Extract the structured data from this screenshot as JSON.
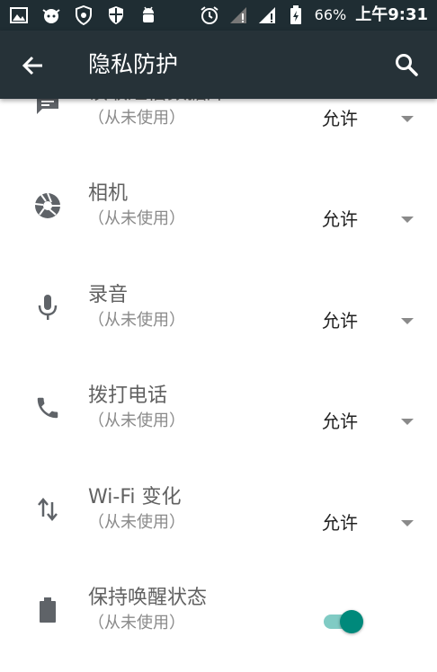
{
  "status_bar": {
    "left_icons": [
      "image-icon",
      "cow-icon",
      "shield-icon",
      "shield-half-icon",
      "android-icon"
    ],
    "battery": "66%",
    "time": "上午9:31"
  },
  "app_bar": {
    "title": "隐私防护"
  },
  "items": [
    {
      "name": "读取短信数据库",
      "sub": "（从未使用）",
      "value": "允许",
      "icon": "message-icon"
    },
    {
      "name": "相机",
      "sub": "（从未使用）",
      "value": "允许",
      "icon": "camera-icon"
    },
    {
      "name": "录音",
      "sub": "（从未使用）",
      "value": "允许",
      "icon": "microphone-icon"
    },
    {
      "name": "拨打电话",
      "sub": "（从未使用）",
      "value": "允许",
      "icon": "phone-icon"
    },
    {
      "name": "Wi-Fi 变化",
      "sub": "（从未使用）",
      "value": "允许",
      "icon": "swap-vertical-icon"
    },
    {
      "name": "保持唤醒状态",
      "sub": "（从未使用）",
      "toggle_on": true,
      "icon": "battery-icon"
    }
  ],
  "colors": {
    "status_bar": "#1f2d33",
    "app_bar": "#263238",
    "accent": "#00897b"
  }
}
